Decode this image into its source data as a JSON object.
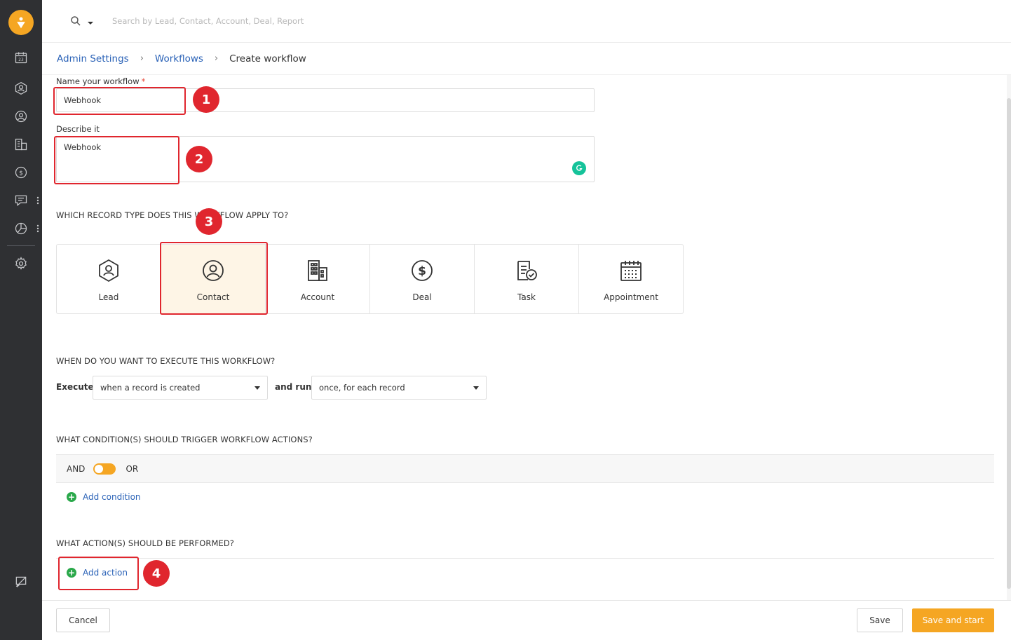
{
  "sidebar": {
    "logo_icon": "freshsales-logo-icon",
    "items": [
      {
        "name": "calendar-icon"
      },
      {
        "name": "lead-icon"
      },
      {
        "name": "contact-icon"
      },
      {
        "name": "account-icon"
      },
      {
        "name": "deal-icon"
      },
      {
        "name": "chat-icon"
      },
      {
        "name": "reports-icon"
      },
      {
        "name": "settings-icon"
      },
      {
        "name": "announcement-icon"
      }
    ]
  },
  "search": {
    "placeholder": "Search by Lead, Contact, Account, Deal, Report"
  },
  "breadcrumb": {
    "items": [
      "Admin Settings",
      "Workflows"
    ],
    "current": "Create workflow",
    "separator": "›"
  },
  "form": {
    "name_label": "Name your workflow",
    "required_mark": "*",
    "name_value": "Webhook",
    "describe_label": "Describe it",
    "describe_value": "Webhook"
  },
  "record_type": {
    "heading": "WHICH RECORD TYPE DOES THIS WORKFLOW APPLY TO?",
    "options": [
      "Lead",
      "Contact",
      "Account",
      "Deal",
      "Task",
      "Appointment"
    ],
    "selected": "Contact"
  },
  "execute": {
    "heading": "WHEN DO YOU WANT TO EXECUTE THIS WORKFLOW?",
    "execute_label": "Execute",
    "execute_value": "when a record is created",
    "run_label": "and run",
    "run_value": "once, for each record"
  },
  "conditions": {
    "heading": "WHAT CONDITION(S) SHOULD TRIGGER WORKFLOW ACTIONS?",
    "and_label": "AND",
    "or_label": "OR",
    "add_label": "Add condition"
  },
  "actions": {
    "heading": "WHAT ACTION(S) SHOULD BE PERFORMED?",
    "add_label": "Add action"
  },
  "footer": {
    "cancel_label": "Cancel",
    "save_label": "Save",
    "save_start_label": "Save and start"
  },
  "annotations": [
    "1",
    "2",
    "3",
    "4"
  ],
  "colors": {
    "accent": "#f5a623",
    "link": "#2a62b7",
    "annotation": "#e0262e",
    "sidebar": "#2f3033",
    "selected_bg": "#fef5e6",
    "add_icon": "#2aa84a"
  }
}
